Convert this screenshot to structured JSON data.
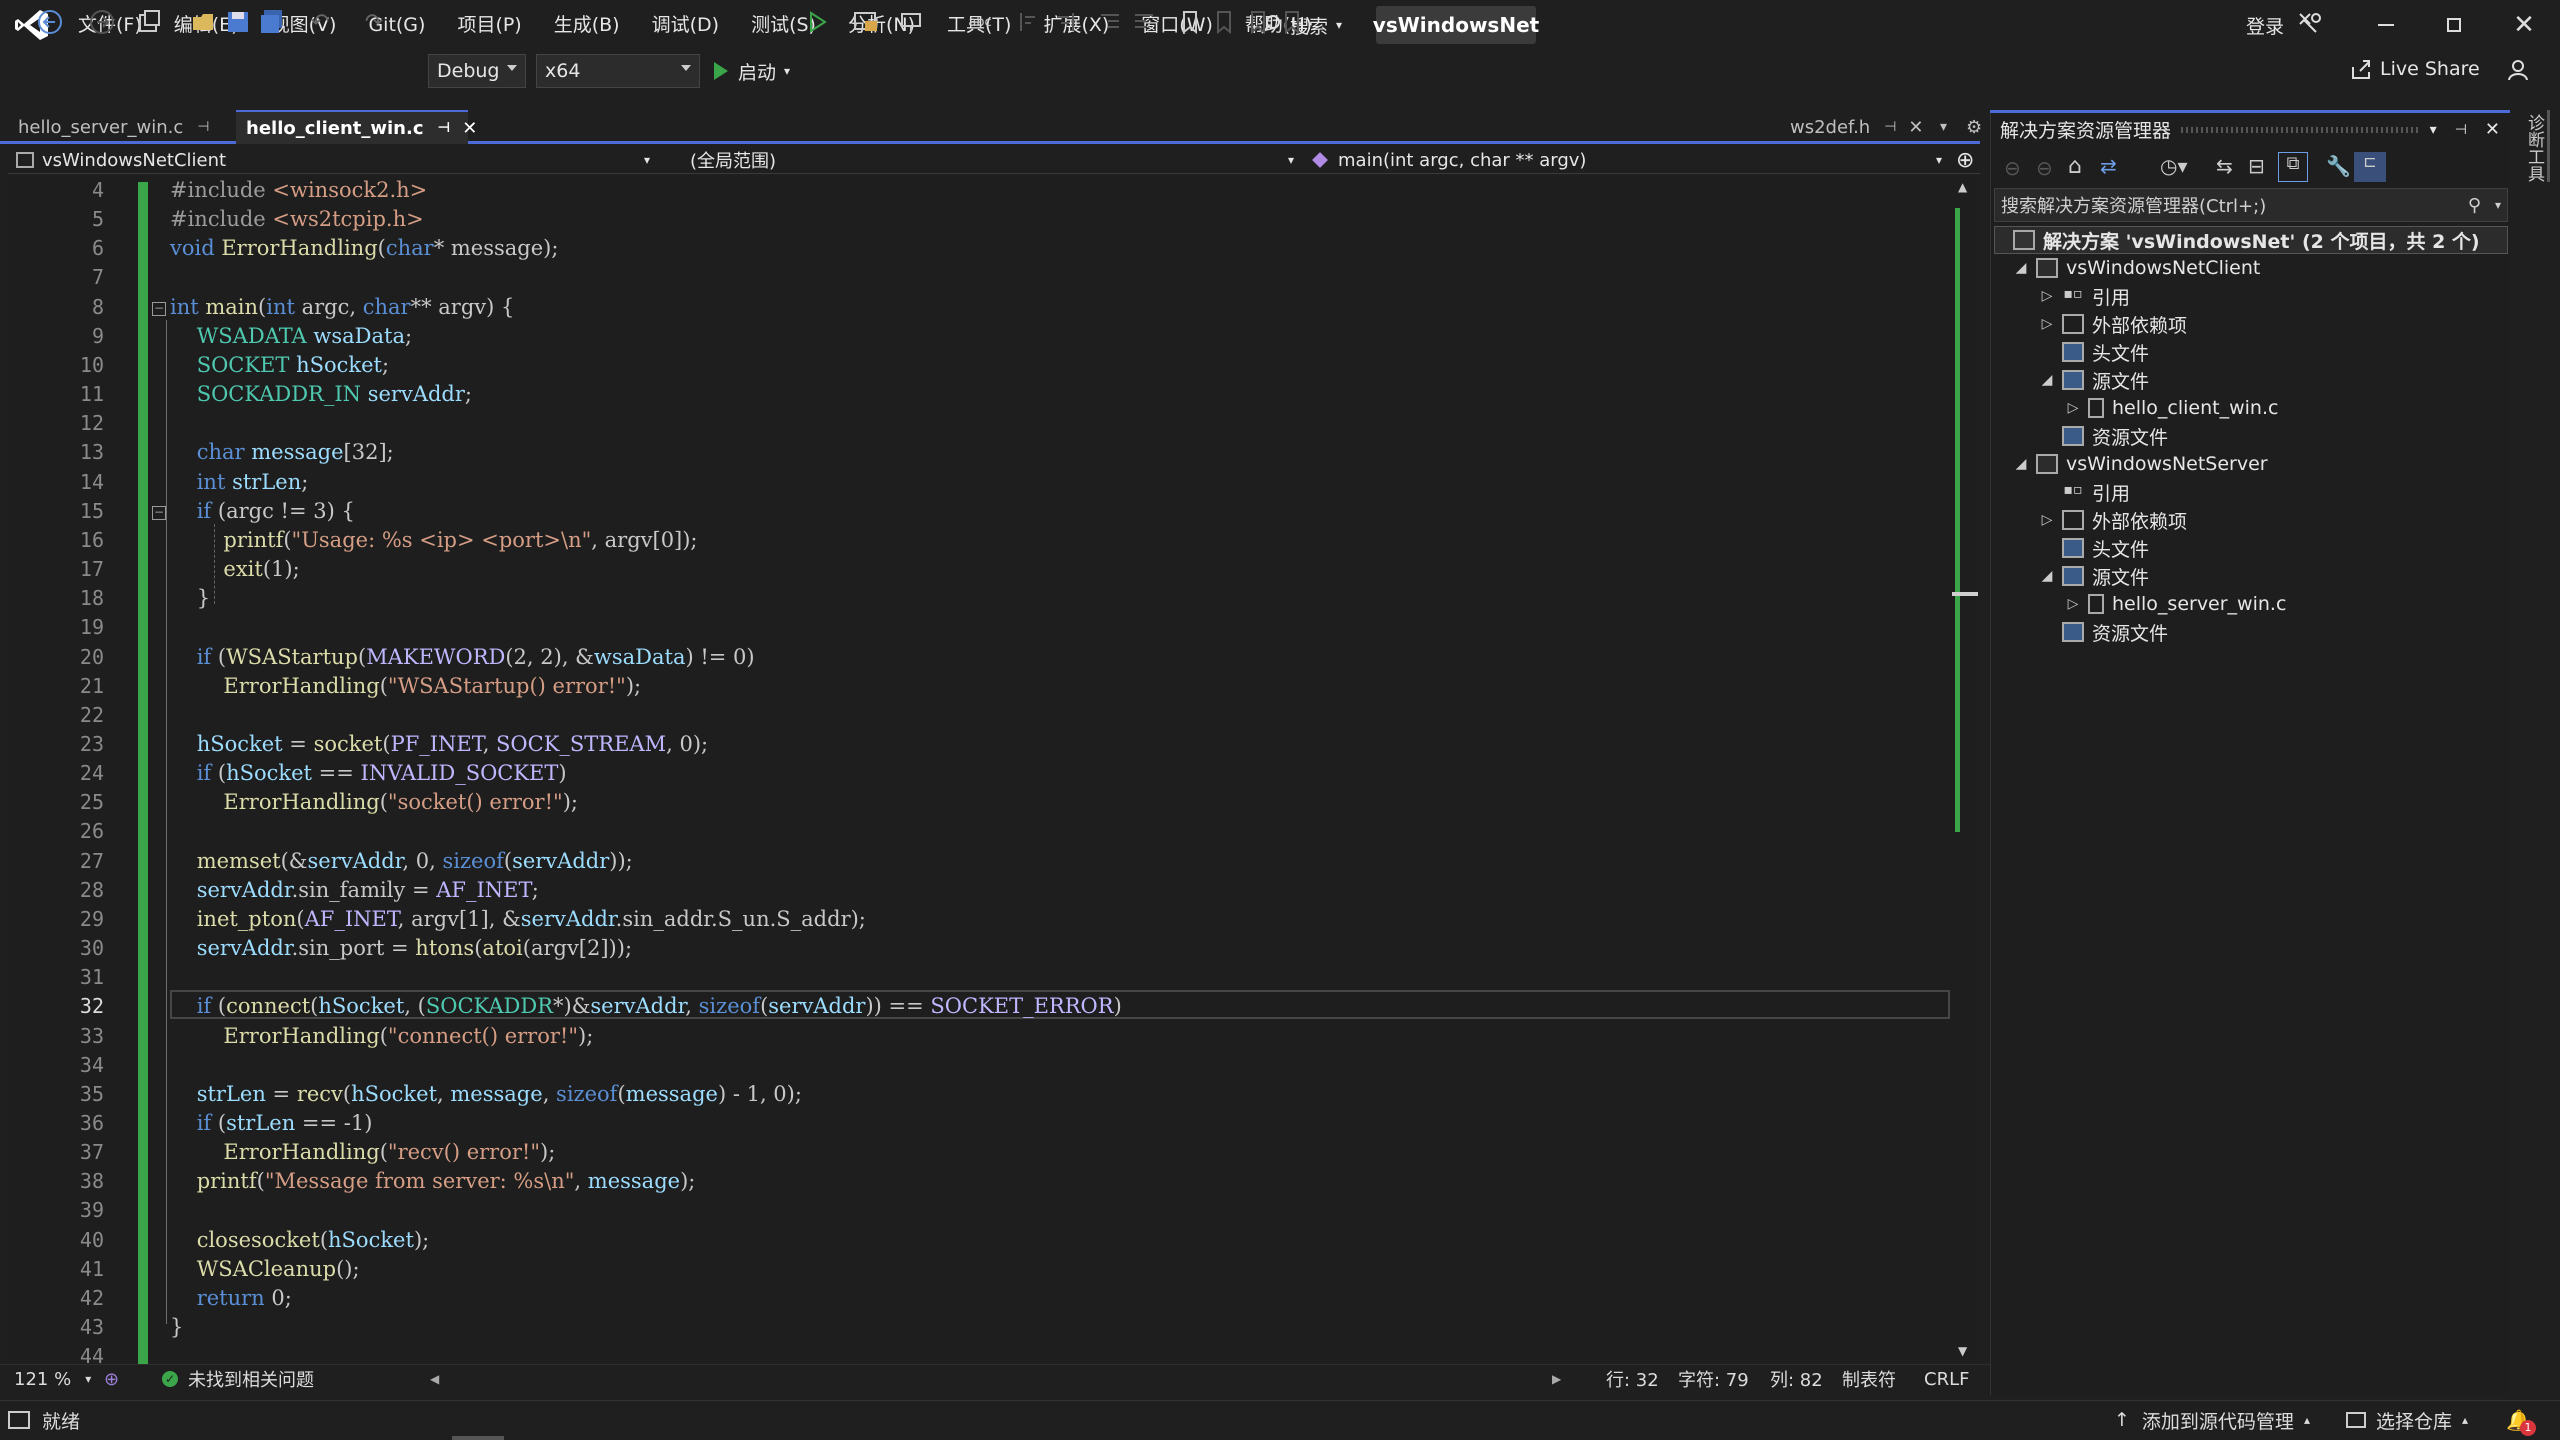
{
  "menubar": {
    "items": [
      "文件(F)",
      "编辑(E)",
      "视图(V)",
      "Git(G)",
      "项目(P)",
      "生成(B)",
      "调试(D)",
      "测试(S)",
      "分析(N)",
      "工具(T)",
      "扩展(X)",
      "窗口(W)",
      "帮助(H)"
    ],
    "search_label": "搜索",
    "solution_name": "vsWindowsNet",
    "login_label": "登录"
  },
  "toolbar": {
    "config": "Debug",
    "platform": "x64",
    "start_label": "启动",
    "liveshare_label": "Live Share"
  },
  "tabs": [
    {
      "label": "hello_server_win.c"
    },
    {
      "label": "hello_client_win.c"
    },
    {
      "label": "ws2def.h"
    }
  ],
  "navbar": {
    "project": "vsWindowsNetClient",
    "scope": "(全局范围)",
    "member": "main(int argc, char ** argv)"
  },
  "editor": {
    "line_numbers": [
      "4",
      "5",
      "6",
      "7",
      "8",
      "9",
      "10",
      "11",
      "12",
      "13",
      "14",
      "15",
      "16",
      "17",
      "18",
      "19",
      "20",
      "21",
      "22",
      "23",
      "24",
      "25",
      "26",
      "27",
      "28",
      "29",
      "30",
      "31",
      "32",
      "33",
      "34",
      "35",
      "36",
      "37",
      "38",
      "39",
      "40",
      "41",
      "42",
      "43",
      "44"
    ]
  },
  "editor_status": {
    "zoom": "121 %",
    "issues": "未找到相关问题",
    "line": "行: 32",
    "char": "字符: 79",
    "col": "列: 82",
    "tabs": "制表符",
    "eol": "CRLF"
  },
  "solution_explorer": {
    "title": "解决方案资源管理器",
    "search_placeholder": "搜索解决方案资源管理器(Ctrl+;)",
    "solution_node": "解决方案 'vsWindowsNet' (2 个项目，共 2 个)",
    "nodes": [
      {
        "label": "vsWindowsNetClient"
      },
      {
        "label": "引用"
      },
      {
        "label": "外部依赖项"
      },
      {
        "label": "头文件"
      },
      {
        "label": "源文件"
      },
      {
        "label": "hello_client_win.c"
      },
      {
        "label": "资源文件"
      },
      {
        "label": "vsWindowsNetServer"
      },
      {
        "label": "引用"
      },
      {
        "label": "外部依赖项"
      },
      {
        "label": "头文件"
      },
      {
        "label": "源文件"
      },
      {
        "label": "hello_server_win.c"
      },
      {
        "label": "资源文件"
      }
    ]
  },
  "right_rail": {
    "label": "诊断工具"
  },
  "statusbar": {
    "ready": "就绪",
    "add_source_control": "添加到源代码管理",
    "select_repo": "选择仓库",
    "notification_count": "1"
  },
  "colors": {
    "accent": "#4d6ad9",
    "change_bar": "#3ba54a"
  }
}
